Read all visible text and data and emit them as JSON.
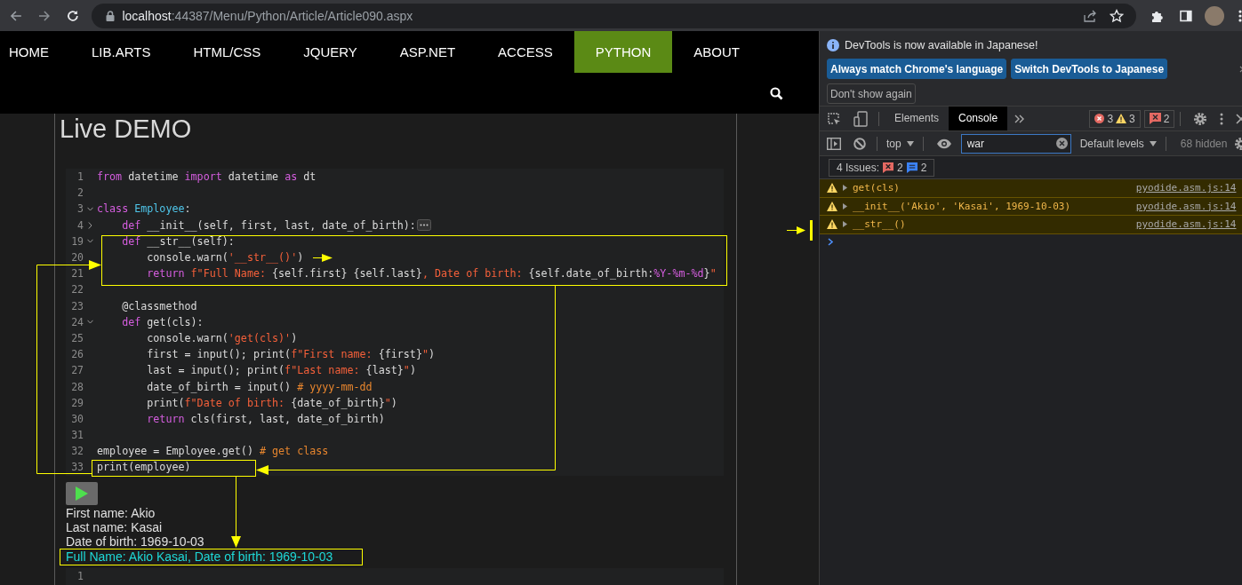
{
  "browser": {
    "url": "**localhost**:44387/Menu/Python/Article/Article090.aspx"
  },
  "nav": {
    "items": [
      {
        "label": "HOME",
        "selected": false
      },
      {
        "label": "LIB.ARTS",
        "selected": false
      },
      {
        "label": "HTML/CSS",
        "selected": false
      },
      {
        "label": "JQUERY",
        "selected": false
      },
      {
        "label": "ASP.NET",
        "selected": false
      },
      {
        "label": "ACCESS",
        "selected": false
      },
      {
        "label": "PYTHON",
        "selected": true
      },
      {
        "label": "ABOUT",
        "selected": false
      }
    ]
  },
  "demo": {
    "title": "Live DEMO",
    "code_lines": [
      {
        "number": "1",
        "tokens": [
          {
            "kind": "keyword",
            "text": "from"
          },
          {
            "kind": "plain",
            "text": " datetime "
          },
          {
            "kind": "keyword",
            "text": "import"
          },
          {
            "kind": "plain",
            "text": " datetime "
          },
          {
            "kind": "keyword",
            "text": "as"
          },
          {
            "kind": "plain",
            "text": " dt"
          }
        ]
      },
      {
        "number": "2"
      },
      {
        "number": "3",
        "collapsed": false,
        "tokens": [
          {
            "kind": "keyword",
            "text": "class"
          },
          {
            "kind": "class",
            "text": " Employee"
          },
          {
            "kind": "plain",
            "text": ":"
          }
        ]
      },
      {
        "number": "4",
        "collapsed": true,
        "tokens": [
          {
            "kind": "keyword",
            "text": "    def"
          },
          {
            "kind": "plain",
            "text": " __init__(self, first, last, date_of_birth):"
          }
        ]
      },
      {
        "number": "19",
        "collapsed": false,
        "tokens": [
          {
            "kind": "keyword",
            "text": "    def"
          },
          {
            "kind": "plain",
            "text": " __str__(self):"
          }
        ]
      },
      {
        "number": "20",
        "tokens": [
          {
            "kind": "plain",
            "text": "        console.warn("
          },
          {
            "kind": "string",
            "text": "'__str__()'"
          },
          {
            "kind": "plain",
            "text": ")"
          }
        ]
      },
      {
        "number": "21",
        "tokens": [
          {
            "kind": "keyword",
            "text": "        return"
          },
          {
            "kind": "string",
            "text": " f\"Full Name: "
          },
          {
            "kind": "plain",
            "text": "{self.first} {self.last}"
          },
          {
            "kind": "string",
            "text": ", Date of birth: "
          },
          {
            "kind": "plain",
            "text": "{self.date_of_birth:"
          },
          {
            "kind": "format",
            "text": "%Y-%m-%d"
          },
          {
            "kind": "plain",
            "text": "}"
          },
          {
            "kind": "string",
            "text": "\""
          }
        ]
      },
      {
        "number": "22"
      },
      {
        "number": "23",
        "tokens": [
          {
            "kind": "plain",
            "text": "    @classmethod"
          }
        ]
      },
      {
        "number": "24",
        "collapsed": false,
        "tokens": [
          {
            "kind": "keyword",
            "text": "    def"
          },
          {
            "kind": "plain",
            "text": " get(cls):"
          }
        ]
      },
      {
        "number": "25",
        "tokens": [
          {
            "kind": "plain",
            "text": "        console.warn("
          },
          {
            "kind": "string",
            "text": "'get(cls)'"
          },
          {
            "kind": "plain",
            "text": ")"
          }
        ]
      },
      {
        "number": "26",
        "tokens": [
          {
            "kind": "plain",
            "text": "        first = input(); print("
          },
          {
            "kind": "string",
            "text": "f\"First name: "
          },
          {
            "kind": "plain",
            "text": "{first}"
          },
          {
            "kind": "string",
            "text": "\""
          },
          {
            "kind": "plain",
            "text": ")"
          }
        ]
      },
      {
        "number": "27",
        "tokens": [
          {
            "kind": "plain",
            "text": "        last = input(); print("
          },
          {
            "kind": "string",
            "text": "f\"Last name: "
          },
          {
            "kind": "plain",
            "text": "{last}"
          },
          {
            "kind": "string",
            "text": "\""
          },
          {
            "kind": "plain",
            "text": ")"
          }
        ]
      },
      {
        "number": "28",
        "tokens": [
          {
            "kind": "plain",
            "text": "        date_of_birth = input() "
          },
          {
            "kind": "comment",
            "text": "# yyyy-mm-dd"
          }
        ]
      },
      {
        "number": "29",
        "tokens": [
          {
            "kind": "plain",
            "text": "        print("
          },
          {
            "kind": "string",
            "text": "f\"Date of birth: "
          },
          {
            "kind": "plain",
            "text": "{date_of_birth}"
          },
          {
            "kind": "string",
            "text": "\""
          },
          {
            "kind": "plain",
            "text": ")"
          }
        ]
      },
      {
        "number": "30",
        "tokens": [
          {
            "kind": "keyword",
            "text": "        return"
          },
          {
            "kind": "plain",
            "text": " cls(first, last, date_of_birth)"
          }
        ]
      },
      {
        "number": "31"
      },
      {
        "number": "32",
        "tokens": [
          {
            "kind": "plain",
            "text": "employee = Employee.get() "
          },
          {
            "kind": "comment",
            "text": "# get class"
          }
        ]
      },
      {
        "number": "33",
        "tokens": [
          {
            "kind": "plain",
            "text": "print(employee)"
          }
        ]
      }
    ],
    "output": [
      {
        "text": "First name: Akio",
        "highlighted": false
      },
      {
        "text": "Last name: Kasai",
        "highlighted": false
      },
      {
        "text": "Date of birth: 1969-10-03",
        "highlighted": false
      },
      {
        "text": "Full Name: Akio Kasai, Date of birth: 1969-10-03",
        "highlighted": true
      }
    ],
    "input_editor": {
      "lines": [
        {
          "number": "1"
        }
      ]
    }
  },
  "devtools": {
    "infobar": {
      "message": "DevTools is now available in Japanese!",
      "buttons": [
        {
          "label": "Always match Chrome's language",
          "kind": "primary"
        },
        {
          "label": "Switch DevTools to Japanese",
          "kind": "primary"
        },
        {
          "label": "Don't show again",
          "kind": "secondary"
        }
      ]
    },
    "tabs": [
      {
        "label": "Elements",
        "selected": false
      },
      {
        "label": "Console",
        "selected": true
      }
    ],
    "counts": {
      "errors": "3",
      "warnings": "3",
      "issues": "2"
    },
    "context": "top",
    "filter": {
      "value": "war"
    },
    "levels": "Default levels",
    "hidden": "68 hidden",
    "issues": {
      "label": "4 Issues:",
      "errors": "2",
      "infos": "2"
    },
    "messages": [
      {
        "kind": "warning",
        "text": "get(cls)",
        "source": "pyodide.asm.js:14"
      },
      {
        "kind": "warning",
        "text": "__init__('Akio', 'Kasai', 1969-10-03)",
        "source": "pyodide.asm.js:14"
      },
      {
        "kind": "warning",
        "text": "__str__()",
        "source": "pyodide.asm.js:14"
      }
    ]
  }
}
